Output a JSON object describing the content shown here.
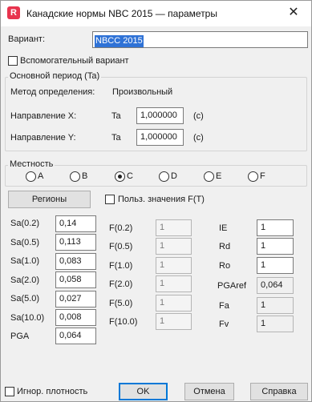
{
  "window": {
    "title": "Канадские нормы NBC 2015 — параметры",
    "app_icon_letter": "R"
  },
  "variant": {
    "label": "Вариант:",
    "value": "NBCC 2015"
  },
  "aux_variant": {
    "label": "Вспомогательный вариант",
    "checked": false
  },
  "period": {
    "title": "Основной период (Ta)",
    "method_label": "Метод определения:",
    "method_value": "Произвольный",
    "dir_x": {
      "label": "Направление X:",
      "symbol": "Ta",
      "value": "1,000000",
      "unit": "(c)"
    },
    "dir_y": {
      "label": "Направление Y:",
      "symbol": "Ta",
      "value": "1,000000",
      "unit": "(c)"
    }
  },
  "site": {
    "title": "Местность",
    "options": [
      {
        "label": "A",
        "checked": false
      },
      {
        "label": "B",
        "checked": false
      },
      {
        "label": "C",
        "checked": true
      },
      {
        "label": "D",
        "checked": false
      },
      {
        "label": "E",
        "checked": false
      },
      {
        "label": "F",
        "checked": false
      }
    ]
  },
  "regions_button": "Регионы",
  "user_f": {
    "label": "Польз. значения F(T)",
    "checked": false
  },
  "sa": [
    {
      "label": "Sa(0.2)",
      "value": "0,14"
    },
    {
      "label": "Sa(0.5)",
      "value": "0,113"
    },
    {
      "label": "Sa(1.0)",
      "value": "0,083"
    },
    {
      "label": "Sa(2.0)",
      "value": "0,058"
    },
    {
      "label": "Sa(5.0)",
      "value": "0,027"
    },
    {
      "label": "Sa(10.0)",
      "value": "0,008"
    },
    {
      "label": "PGA",
      "value": "0,064"
    }
  ],
  "f": [
    {
      "label": "F(0.2)",
      "value": "1"
    },
    {
      "label": "F(0.5)",
      "value": "1"
    },
    {
      "label": "F(1.0)",
      "value": "1"
    },
    {
      "label": "F(2.0)",
      "value": "1"
    },
    {
      "label": "F(5.0)",
      "value": "1"
    },
    {
      "label": "F(10.0)",
      "value": "1"
    }
  ],
  "params": {
    "ie": {
      "label": "IE",
      "value": "1"
    },
    "rd": {
      "label": "Rd",
      "value": "1"
    },
    "ro": {
      "label": "Ro",
      "value": "1"
    },
    "pgaref": {
      "label": "PGAref",
      "value": "0,064"
    },
    "fa": {
      "label": "Fa",
      "value": "1"
    },
    "fv": {
      "label": "Fv",
      "value": "1"
    }
  },
  "ignore_density": {
    "label": "Игнор. плотность",
    "checked": false
  },
  "buttons": {
    "ok": "OK",
    "cancel": "Отмена",
    "help": "Справка"
  }
}
